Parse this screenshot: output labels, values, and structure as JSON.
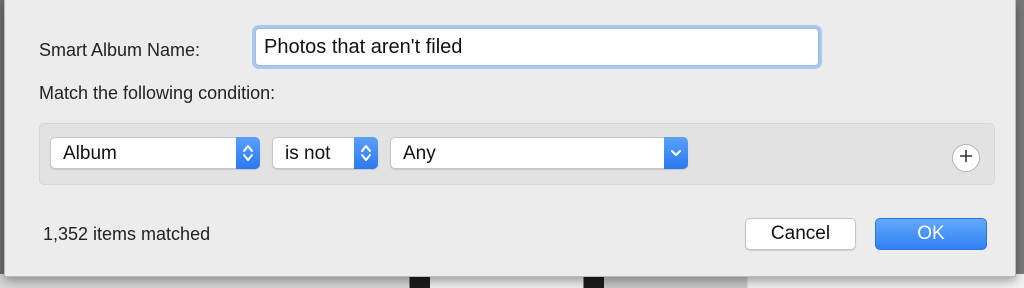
{
  "dialog": {
    "name_label": "Smart Album Name:",
    "name_value": "Photos that aren't filed",
    "condition_label": "Match the following condition:"
  },
  "rule": {
    "field": "Album",
    "operator": "is not",
    "value": "Any"
  },
  "footer": {
    "match_count": "1,352 items matched",
    "cancel_label": "Cancel",
    "ok_label": "OK"
  },
  "icons": {
    "stepper": "up-down-arrows-icon",
    "dropdown": "chevron-down-icon",
    "add": "plus-icon"
  },
  "colors": {
    "accent": "#2f80f4",
    "focus_ring": "#a9c8ef"
  }
}
